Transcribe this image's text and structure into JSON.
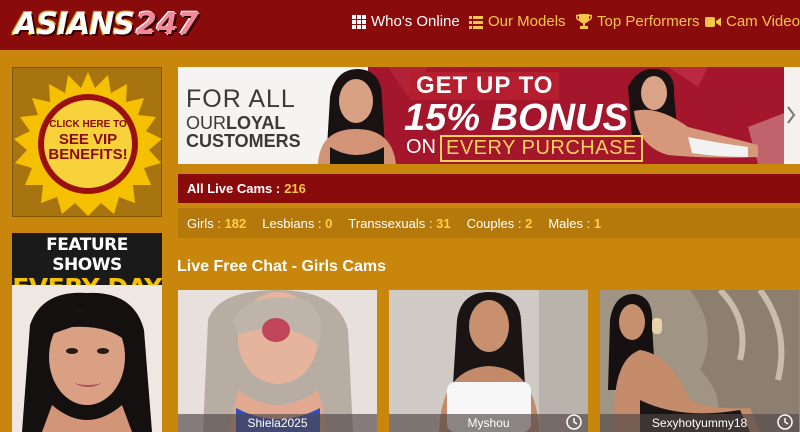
{
  "brand": {
    "logo_part1": "ASIANS",
    "logo_part2": "247"
  },
  "nav": {
    "items": [
      {
        "label": "Who's Online",
        "icon": "grid-icon",
        "color": "#ffffff"
      },
      {
        "label": "Our Models",
        "icon": "list-icon",
        "color": "#f6c54a"
      },
      {
        "label": "Top Performers",
        "icon": "trophy-icon",
        "color": "#f6c54a"
      },
      {
        "label": "Cam Videos",
        "icon": "video-camera-icon",
        "color": "#f6c54a"
      }
    ]
  },
  "sidebar": {
    "vip": {
      "line1": "CLICK HERE TO",
      "line2": "SEE VIP",
      "line3": "BENEFITS!"
    },
    "feature": {
      "line1": "FEATURE SHOWS",
      "line2": "EVERY DAY"
    }
  },
  "banner": {
    "for_all": "FOR ALL",
    "our": "OUR",
    "loyal": "LOYAL",
    "customers": "CUSTOMERS",
    "get_up_to": "GET UP TO",
    "bonus": "15% BONUS",
    "on": "ON",
    "every_purchase": "EVERY PURCHASE"
  },
  "stats": {
    "all_label": "All Live Cams :",
    "all_count": "216",
    "categories": [
      {
        "label": "Girls :",
        "count": "182"
      },
      {
        "label": "Lesbians :",
        "count": "0"
      },
      {
        "label": "Transsexuals :",
        "count": "31"
      },
      {
        "label": "Couples :",
        "count": "2"
      },
      {
        "label": "Males :",
        "count": "1"
      }
    ]
  },
  "main": {
    "section_title": "Live Free Chat - Girls Cams",
    "cams": [
      {
        "name": "Shiela2025"
      },
      {
        "name": "Myshou"
      },
      {
        "name": "Sexyhotyummy18"
      }
    ]
  },
  "colors": {
    "header_bg": "#8a0b0b",
    "page_bg": "#c8860d",
    "accent_gold": "#f6c54a",
    "catbar_bg": "#b5780a"
  }
}
